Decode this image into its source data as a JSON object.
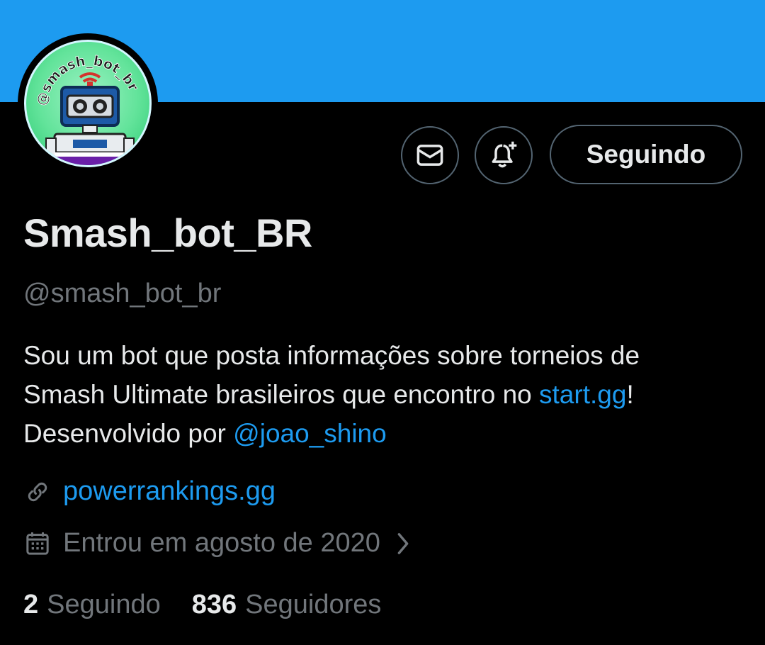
{
  "profile": {
    "display_name": "Smash_bot_BR",
    "handle": "@smash_bot_br",
    "avatar_text": "@smash_bot_br"
  },
  "actions": {
    "message_icon": "envelope-icon",
    "notify_icon": "bell-plus-icon",
    "follow_label": "Seguindo"
  },
  "bio": {
    "line1_a": "Sou um bot que posta informações sobre torneios de",
    "line2_a": "Smash Ultimate brasileiros que encontro no ",
    "line2_link": "start.gg",
    "line2_b": "!",
    "line3_a": "Desenvolvido por ",
    "line3_link": "@joao_shino"
  },
  "meta": {
    "website_icon": "link-icon",
    "website": "powerrankings.gg",
    "joined_icon": "calendar-icon",
    "joined": "Entrou em agosto de 2020"
  },
  "stats": {
    "following_count": "2",
    "following_label": "Seguindo",
    "followers_count": "836",
    "followers_label": "Seguidores"
  },
  "colors": {
    "banner": "#1d9bf0",
    "link": "#1d9bf0",
    "secondary_text": "#71767b",
    "primary_text": "#e7e9ea"
  }
}
